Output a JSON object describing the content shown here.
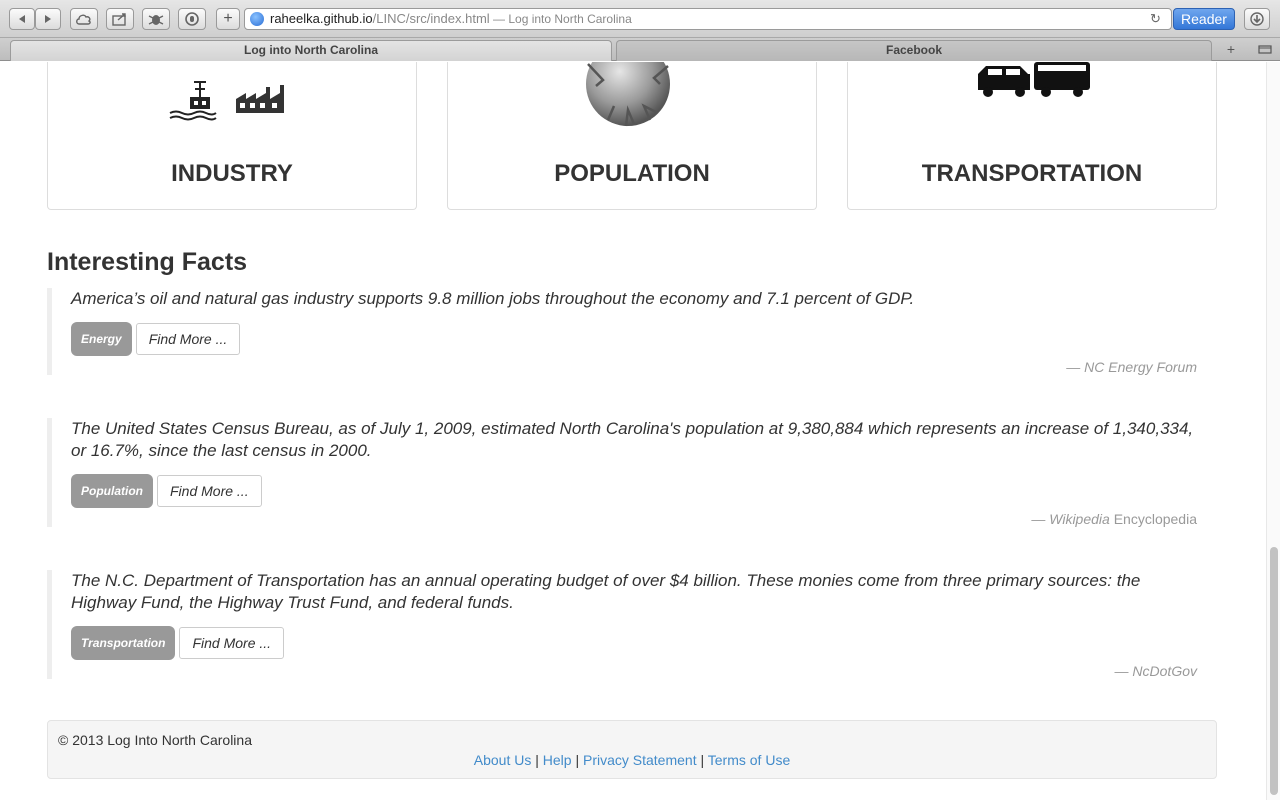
{
  "browser": {
    "url_host": "raheelka.github.io",
    "url_path": "/LINC/src/index.html",
    "url_title": " — Log into North Carolina",
    "reader_label": "Reader",
    "tabs": [
      {
        "label": "Log into North Carolina",
        "active": true
      },
      {
        "label": "Facebook",
        "active": false
      }
    ],
    "add_tab_label": "+"
  },
  "categories": [
    {
      "title": "INDUSTRY",
      "icon": "industry-icon"
    },
    {
      "title": "POPULATION",
      "icon": "globe-icon"
    },
    {
      "title": "TRANSPORTATION",
      "icon": "vehicles-icon"
    }
  ],
  "facts": {
    "heading": "Interesting Facts",
    "items": [
      {
        "text": "America’s oil and natural gas industry supports 9.8 million jobs throughout the economy and 7.1 percent of GDP.",
        "label": "Energy",
        "button": "Find More ...",
        "source_prefix": "— NC Energy Forum",
        "source_suffix": ""
      },
      {
        "text": "The United States Census Bureau, as of July 1, 2009, estimated North Carolina's population at 9,380,884 which represents an increase of 1,340,334, or 16.7%, since the last census in 2000.",
        "label": "Population",
        "button": "Find More ...",
        "source_prefix": "— Wikipedia",
        "source_suffix": " Encyclopedia"
      },
      {
        "text": "The N.C. Department of Transportation has an annual operating budget of over $4 billion. These monies come from three primary sources: the Highway Fund, the Highway Trust Fund, and federal funds.",
        "label": "Transportation",
        "button": "Find More ...",
        "source_prefix": "— NcDotGov",
        "source_suffix": ""
      }
    ]
  },
  "footer": {
    "copyright": "© 2013 Log Into North Carolina",
    "links": [
      "About Us",
      "Help",
      "Privacy Statement",
      "Terms of Use"
    ],
    "separator": "|"
  },
  "colors": {
    "link": "#428bca",
    "badge": "#999999",
    "reader": "#3477d7"
  }
}
